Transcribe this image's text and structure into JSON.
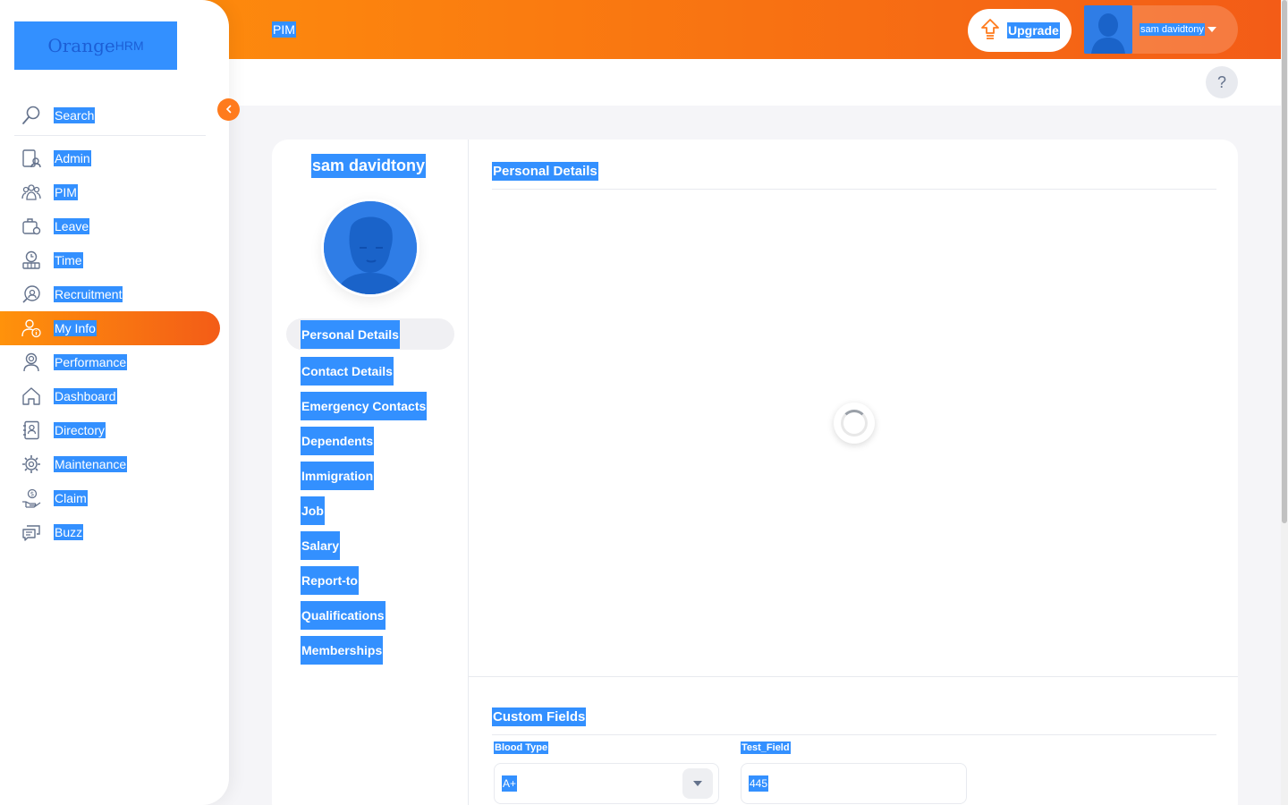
{
  "header": {
    "module_title": "PIM",
    "upgrade_label": "Upgrade",
    "user_name": "sam davidtony",
    "accent_start": "#ff920b",
    "accent_end": "#f35c17"
  },
  "help": {
    "label": "?"
  },
  "brand": {
    "logo_text": "Orange",
    "logo_suffix": "HRM"
  },
  "sidebar": {
    "search_label": "Search",
    "items": [
      {
        "label": "Admin",
        "icon": "admin-icon"
      },
      {
        "label": "PIM",
        "icon": "pim-icon"
      },
      {
        "label": "Leave",
        "icon": "leave-icon"
      },
      {
        "label": "Time",
        "icon": "time-icon"
      },
      {
        "label": "Recruitment",
        "icon": "recruitment-icon"
      },
      {
        "label": "My Info",
        "icon": "my-info-icon",
        "active": true
      },
      {
        "label": "Performance",
        "icon": "performance-icon"
      },
      {
        "label": "Dashboard",
        "icon": "dashboard-icon"
      },
      {
        "label": "Directory",
        "icon": "directory-icon"
      },
      {
        "label": "Maintenance",
        "icon": "maintenance-icon"
      },
      {
        "label": "Claim",
        "icon": "claim-icon"
      },
      {
        "label": "Buzz",
        "icon": "buzz-icon"
      }
    ]
  },
  "employee": {
    "name": "sam davidtony",
    "tabs": [
      {
        "label": "Personal Details",
        "active": true
      },
      {
        "label": "Contact Details"
      },
      {
        "label": "Emergency Contacts"
      },
      {
        "label": "Dependents"
      },
      {
        "label": "Immigration"
      },
      {
        "label": "Job"
      },
      {
        "label": "Salary"
      },
      {
        "label": "Report-to"
      },
      {
        "label": "Qualifications"
      },
      {
        "label": "Memberships"
      }
    ]
  },
  "main": {
    "personal_details_title": "Personal Details",
    "custom_fields_title": "Custom Fields",
    "blood_type_label": "Blood Type",
    "blood_type_value": "A+",
    "test_field_label": "Test_Field",
    "test_field_value": "445"
  }
}
